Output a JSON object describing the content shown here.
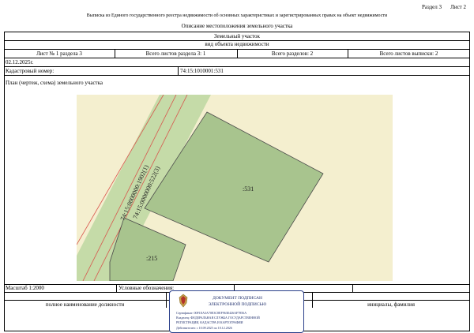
{
  "header": {
    "section": "Раздел 3",
    "sheet": "Лист 2",
    "title": "Выписка из Единого государственного реестра недвижимости об основных характеристиках и зарегистрированных правах на объект недвижимости",
    "subtitle": "Описание местоположения земельного участка"
  },
  "object": {
    "kind": "Земельный участок",
    "kind_caption": "вид объекта недвижимости"
  },
  "sheet_row": {
    "sheet_no": "Лист № 1 раздела 3",
    "total_section": "Всего листов раздела 3: 1",
    "total_sections": "Всего разделов: 2",
    "total_sheets": "Всего листов выписки: 2"
  },
  "date": "02.12.2025г.",
  "cadastral": {
    "label": "Кадастровый номер:",
    "value": "74:15:1010001:531"
  },
  "plan_label": "План (чертеж, схема) земельного участка",
  "map": {
    "colors": {
      "background": "#f4efcf",
      "parcel": "#a8c48e",
      "road": "#c5dba8",
      "border_red": "#d8544b"
    },
    "road_labels": [
      "74:15:0000000:522(3)",
      "74:15:0000000:1902(1)"
    ],
    "parcel_labels": [
      ":531",
      ":215"
    ]
  },
  "footer": {
    "scale": "Масштаб 1:2000",
    "legend": "Условные обозначения:",
    "position_caption": "полное наименование должности",
    "name_caption": "инициалы, фамилия"
  },
  "stamp": {
    "line1": "ДОКУМЕНТ ПОДПИСАН",
    "line2": "ЭЛЕКТРОННОЙ ПОДПИСЬЮ",
    "cert": "Сертификат: 00F1EA3A70E3C8EF963E426AF7856A",
    "owner": "Владелец: ФЕДЕРАЛЬНАЯ СЛУЖБА ГОСУДАРСТВЕННОЙ",
    "owner2": "РЕГИСТРАЦИИ, КАДАСТРА И КАРТОГРАФИИ",
    "valid": "Действителен: с 10.09.2025 по 10.12.2026"
  }
}
